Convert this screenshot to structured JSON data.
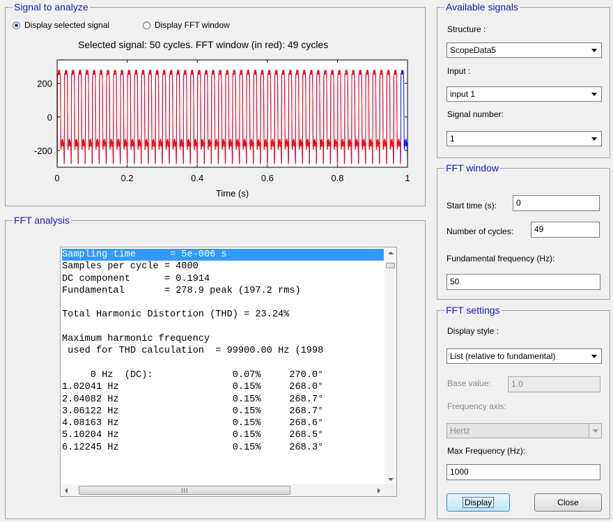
{
  "signal_panel": {
    "title": "Signal to analyze",
    "radio_selected_label": "Display selected signal",
    "radio_fft_label": "Display FFT window",
    "chart_title": "Selected signal: 50 cycles. FFT window (in red): 49 cycles"
  },
  "chart_data": {
    "type": "line",
    "title": "Selected signal: 50 cycles. FFT window (in red): 49 cycles",
    "xlabel": "Time (s)",
    "ylabel": "",
    "xlim": [
      0,
      1
    ],
    "ylim": [
      -300,
      340
    ],
    "x_ticks": [
      "0",
      "0.2",
      "0.4",
      "0.6",
      "0.8",
      "1"
    ],
    "y_ticks": [
      "200",
      "0",
      "-200"
    ],
    "fundamental_hz": 50,
    "cycles_total": 50,
    "cycles_fft_window": 49,
    "fft_window_start_s": 0,
    "fft_window_end_s": 0.98,
    "peak_amplitude": 280,
    "series": [
      {
        "color": "#0000ff",
        "x": [
          0,
          1
        ]
      },
      {
        "color": "#ff0000",
        "x": [
          0,
          0.98
        ]
      }
    ],
    "grid": false
  },
  "fft_panel": {
    "title": "FFT analysis",
    "selected_line_index": 0,
    "lines": [
      "Sampling time      = 5e-006 s",
      "Samples per cycle = 4000",
      "DC component      = 0.1914",
      "Fundamental       = 278.9 peak (197.2 rms)",
      "",
      "Total Harmonic Distortion (THD) = 23.24%",
      "",
      "Maximum harmonic frequency",
      " used for THD calculation  = 99900.00 Hz (1998",
      "",
      "     0 Hz  (DC):              0.07%     270.0°",
      "1.02041 Hz                    0.15%     268.0°",
      "2.04082 Hz                    0.15%     268.7°",
      "3.06122 Hz                    0.15%     268.7°",
      "4.08163 Hz                    0.15%     268.6°",
      "5.10204 Hz                    0.15%     268.5°",
      "6.12245 Hz                    0.15%     268.3°"
    ],
    "hscroll_grip": "III"
  },
  "available_signals": {
    "title": "Available signals",
    "structure_label": "Structure :",
    "structure_value": "ScopeData5",
    "input_label": "Input :",
    "input_value": "input 1",
    "signal_number_label": "Signal number:",
    "signal_number_value": "1"
  },
  "fft_window": {
    "title": "FFT window",
    "start_time_label": "Start time (s):",
    "start_time_value": "0",
    "cycles_label": "Number of cycles:",
    "cycles_value": "49",
    "fund_freq_label": "Fundamental frequency (Hz):",
    "fund_freq_value": "50"
  },
  "fft_settings": {
    "title": "FFT settings",
    "display_style_label": "Display style :",
    "display_style_value": "List (relative to fundamental)",
    "base_value_label": "Base value:",
    "base_value_value": "1.0",
    "freq_axis_label": "Frequency axis:",
    "freq_axis_value": "Hertz",
    "max_freq_label": "Max Frequency (Hz):",
    "max_freq_value": "1000",
    "display_button": "Display",
    "close_button": "Close"
  }
}
